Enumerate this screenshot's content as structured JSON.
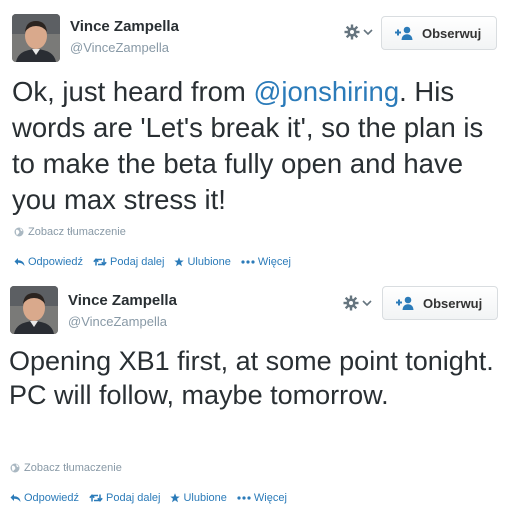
{
  "colors": {
    "link": "#2b7bb9",
    "muted": "#8899a6",
    "text": "#292f33"
  },
  "tweets": [
    {
      "fullname": "Vince Zampella",
      "username": "@VinceZampella",
      "follow_label": "Obserwuj",
      "text_before": "Ok, just heard from ",
      "mention": "@jonshiring",
      "text_after": ". His words are 'Let's break it', so the plan is to make the beta fully open and have you max stress it!",
      "translate_label": "Zobacz tłumaczenie",
      "actions": {
        "reply": "Odpowiedź",
        "retweet": "Podaj dalej",
        "favorite": "Ulubione",
        "more": "Więcej"
      }
    },
    {
      "fullname": "Vince Zampella",
      "username": "@VinceZampella",
      "follow_label": "Obserwuj",
      "text": "Opening XB1 first, at some point tonight. PC will follow, maybe tomorrow.",
      "translate_label": "Zobacz tłumaczenie",
      "actions": {
        "reply": "Odpowiedź",
        "retweet": "Podaj dalej",
        "favorite": "Ulubione",
        "more": "Więcej"
      }
    }
  ]
}
